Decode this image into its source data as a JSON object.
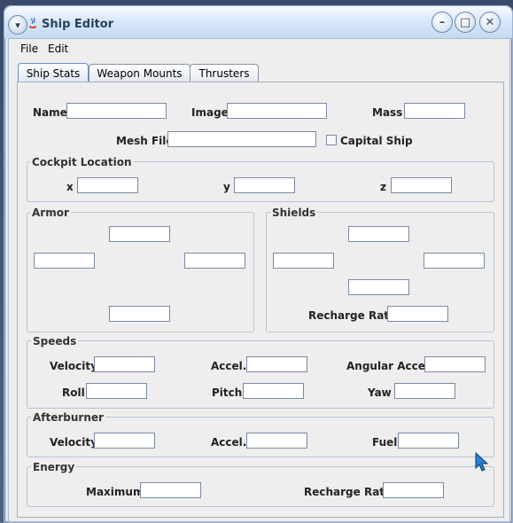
{
  "window": {
    "title": "Ship Editor"
  },
  "menu": {
    "file": "File",
    "edit": "Edit"
  },
  "tabs": [
    "Ship Stats",
    "Weapon Mounts",
    "Thrusters"
  ],
  "stats": {
    "name_label": "Name",
    "image_label": "Image",
    "mass_label": "Mass",
    "mesh_file_label": "Mesh File",
    "capital_ship_label": "Capital Ship"
  },
  "cockpit": {
    "title": "Cockpit Location",
    "x": "x",
    "y": "y",
    "z": "z"
  },
  "armor": {
    "title": "Armor"
  },
  "shields": {
    "title": "Shields",
    "recharge_label": "Recharge Rate"
  },
  "speeds": {
    "title": "Speeds",
    "velocity": "Velocity",
    "accel": "Accel.",
    "angular_accel": "Angular Accel.",
    "roll": "Roll",
    "pitch": "Pitch",
    "yaw": "Yaw"
  },
  "afterburner": {
    "title": "Afterburner",
    "velocity": "Velocity",
    "accel": "Accel.",
    "fuel": "Fuel"
  },
  "energy": {
    "title": "Energy",
    "maximum": "Maximum",
    "recharge_label": "Recharge Rate"
  },
  "colors": {
    "accent": "#6f8cb8",
    "panel_bg": "#eeeeee",
    "field_border": "#7a8aa3"
  }
}
